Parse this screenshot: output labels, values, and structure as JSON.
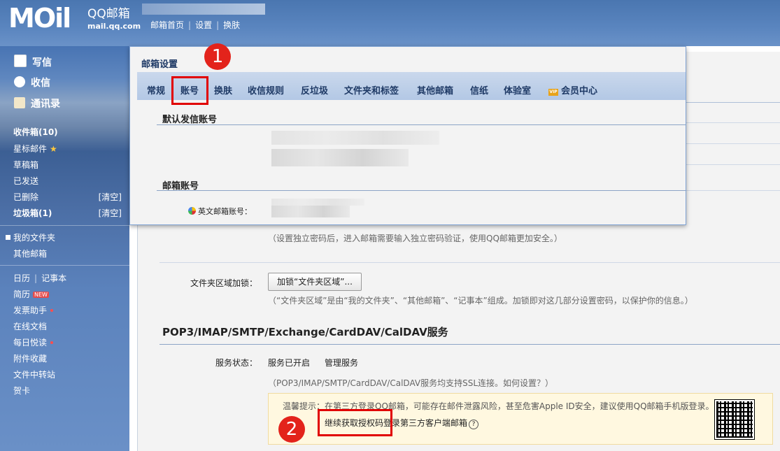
{
  "header": {
    "logo_text": "MOil",
    "product_name": "QQ邮箱",
    "domain": "mail.qq.com",
    "links": [
      "邮箱首页",
      "设置",
      "换肤"
    ]
  },
  "sidebar": {
    "compose": "写信",
    "receive": "收信",
    "contacts": "通讯录",
    "folders": [
      {
        "label": "收件箱(10)"
      },
      {
        "label": "星标邮件"
      },
      {
        "label": "草稿箱"
      },
      {
        "label": "已发送"
      },
      {
        "label": "已删除",
        "action": "[清空]"
      },
      {
        "label": "垃圾箱(1)",
        "action": "[清空]"
      }
    ],
    "my_folders": "我的文件夹",
    "other_mailbox": "其他邮箱",
    "tools": {
      "calendar": "日历",
      "notepad": "记事本",
      "resume": "简历",
      "new_badge": "NEW",
      "invoice": "发票助手",
      "docs": "在线文档",
      "daily": "每日悦读",
      "attachments": "附件收藏",
      "transfer": "文件中转站",
      "cards": "贺卡"
    }
  },
  "panel": {
    "title": "邮箱设置",
    "tabs": [
      "常规",
      "账号",
      "换肤",
      "收信规则",
      "反垃圾",
      "文件夹和标签",
      "其他邮箱",
      "信纸",
      "体验室",
      "会员中心"
    ],
    "vip_badge": "VIP",
    "default_sender_heading": "默认发信账号",
    "mailbox_account_heading": "邮箱账号",
    "english_account_label": "英文邮箱账号："
  },
  "background": {
    "password_hint": "（设置独立密码后，进入邮箱需要输入独立密码验证，使用QQ邮箱更加安全。）",
    "folder_lock_label": "文件夹区域加锁：",
    "folder_lock_button": "加锁“文件夹区域”...",
    "folder_lock_hint": "（“文件夹区域”是由“我的文件夹”、“其他邮箱”、“记事本”组成。加锁即对这几部分设置密码，以保护你的信息。）",
    "service_heading": "POP3/IMAP/SMTP/Exchange/CardDAV/CalDAV服务",
    "service_status_label": "服务状态：",
    "service_status_value": "服务已开启",
    "manage_service": "管理服务",
    "ssl_hint": "（POP3/IMAP/SMTP/CardDAV/CalDAV服务均支持SSL连接。如何设置？）",
    "tip_text": "温馨提示：在第三方登录QQ邮箱，可能存在邮件泄露风险，甚至危害Apple ID安全，建议使用QQ邮箱手机版登录。",
    "tip_link": "继续获取授权码登录第三方客户端邮箱",
    "help_glyph": "?"
  },
  "annotations": {
    "step1": "1",
    "step2": "2",
    "color": "#e10000"
  }
}
